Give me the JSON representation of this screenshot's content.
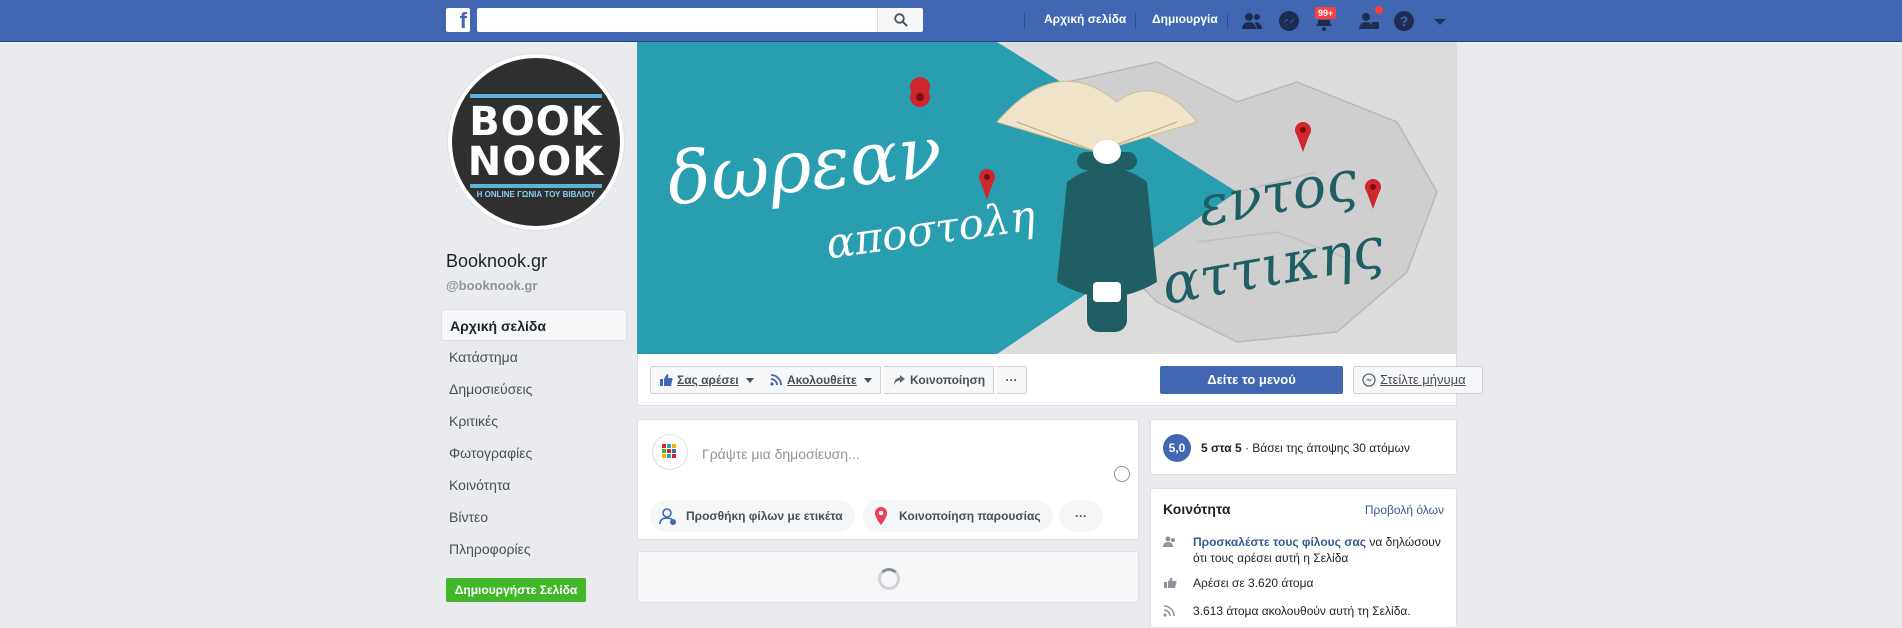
{
  "topbar": {
    "logo_letter": "f",
    "search_placeholder": "",
    "nav_home": "Αρχική σελίδα",
    "nav_create": "Δημιουργία",
    "notifications_badge": "99+"
  },
  "page": {
    "name": "Booknook.gr",
    "handle": "@booknook.gr",
    "logo_line1": "BOOK",
    "logo_line2": "NOOK",
    "logo_tagline": "Η ONLINE ΓΩΝΙΑ ΤΟΥ ΒΙΒΛΙΟΥ"
  },
  "sidebar": {
    "items": [
      {
        "label": "Αρχική σελίδα",
        "active": true
      },
      {
        "label": "Κατάστημα"
      },
      {
        "label": "Δημοσιεύσεις"
      },
      {
        "label": "Κριτικές"
      },
      {
        "label": "Φωτογραφίες"
      },
      {
        "label": "Κοινότητα"
      },
      {
        "label": "Βίντεο"
      },
      {
        "label": "Πληροφορίες"
      }
    ],
    "create_page": "Δημιουργήστε Σελίδα"
  },
  "cover": {
    "text_left1": "δωρεαν",
    "text_left2": "αποστολη",
    "text_right1": "εντος",
    "text_right2": "αττικης"
  },
  "actions": {
    "like": "Σας αρέσει",
    "follow": "Ακολουθείτε",
    "share": "Κοινοποίηση",
    "more": "···",
    "menu": "Δείτε το μενού",
    "message": "Στείλτε μήνυμα"
  },
  "composer": {
    "placeholder": "Γράψτε μια δημοσίευση...",
    "tag_friends": "Προσθήκη φίλων με ετικέτα",
    "check_in": "Κοινοποίηση παρουσίας",
    "more": "···"
  },
  "rating": {
    "score": "5,0",
    "out_of": "5 στα 5",
    "based_on": " · Βάσει της άποψης 30 ατόμων"
  },
  "community": {
    "title": "Κοινότητα",
    "see_all": "Προβολή όλων",
    "invite_link": "Προσκαλέστε τους φίλους σας",
    "invite_rest": " να δηλώσουν ότι τους αρέσει αυτή η Σελίδα",
    "likes": "Αρέσει σε 3.620 άτομα",
    "follows": "3.613 άτομα ακολουθούν αυτή τη Σελίδα."
  },
  "colors": {
    "brand": "#4267b2",
    "cover_teal": "#2ba3b6",
    "create_green": "#42b72a"
  }
}
